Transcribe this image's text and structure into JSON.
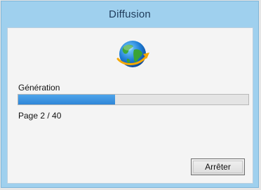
{
  "window": {
    "title": "Diffusion"
  },
  "dialog": {
    "icon": "globe-arrow-icon",
    "status_label": "Génération",
    "progress_fraction": 0.42,
    "page_text": "Page 2 / 40",
    "stop_label": "Arrêter"
  },
  "colors": {
    "titlebar": "#9fd0ee",
    "progress": "#3a90e0",
    "client_bg": "#f4f4f4"
  }
}
